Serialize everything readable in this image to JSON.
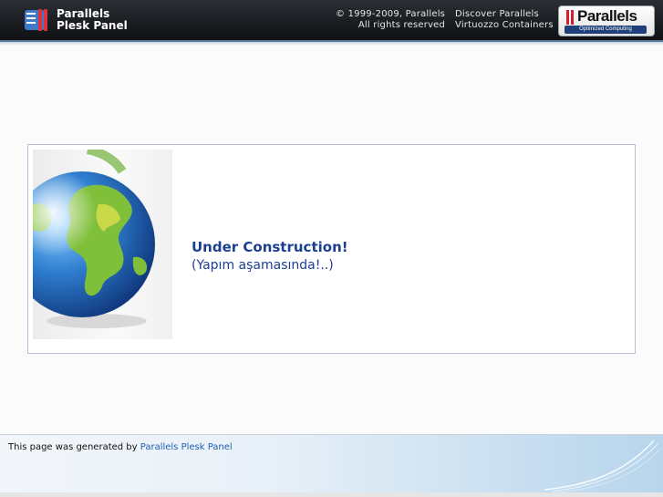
{
  "header": {
    "product_line1": "Parallels",
    "product_line2": "Plesk Panel",
    "copyright_line1": "© 1999-2009, Parallels",
    "copyright_line2": "All rights reserved",
    "link_discover": "Discover Parallels",
    "link_virtuozzo": "Virtuozzo Containers",
    "brand_name": "Parallels",
    "brand_tagline": "Optimized Computing",
    "brand_color": "#d21f2b"
  },
  "content": {
    "title": "Under Construction!",
    "subtitle": "(Yapım aşamasında!..)",
    "text_color": "#1c3f94",
    "image": "globe-image"
  },
  "footer": {
    "prefix": "This page was generated by ",
    "link_text": "Parallels Plesk Panel",
    "link_color": "#1f5fb0"
  }
}
